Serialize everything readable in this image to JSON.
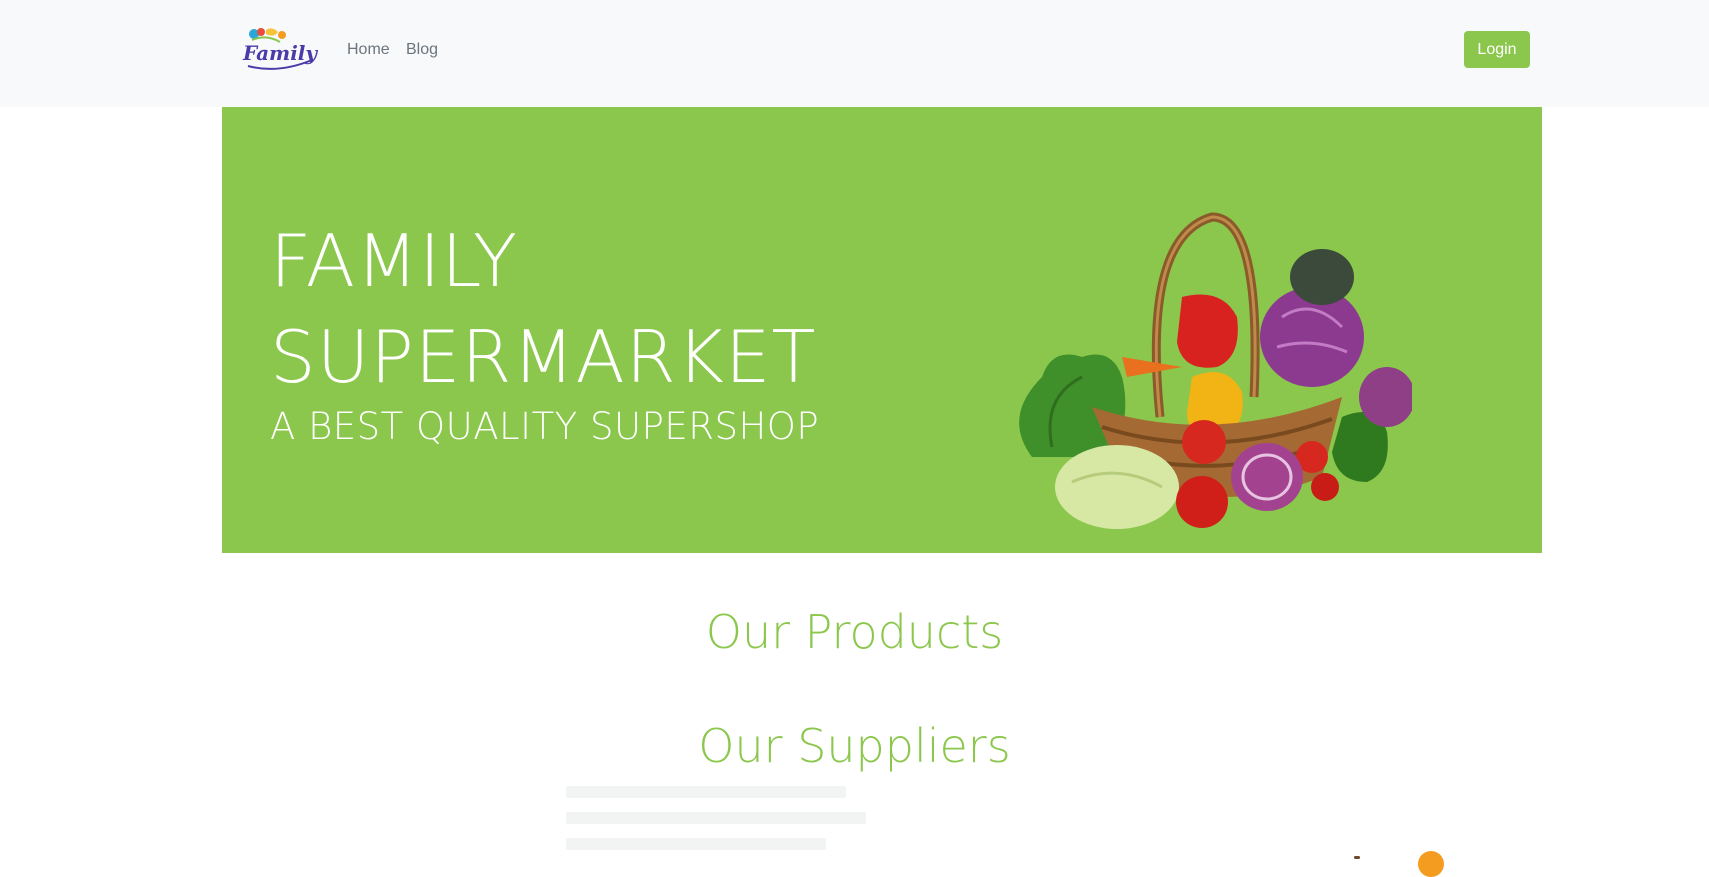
{
  "navbar": {
    "logo_text": "Family",
    "links": [
      {
        "label": "Home"
      },
      {
        "label": "Blog"
      }
    ],
    "login_label": "Login"
  },
  "hero": {
    "title_line1": "FAMILY",
    "title_line2": "SUPERMARKET",
    "subtitle": "A BEST QUALITY SUPERSHOP"
  },
  "sections": {
    "products_heading": "Our Products",
    "suppliers_heading": "Our Suppliers"
  },
  "colors": {
    "brand_green": "#8bc74c",
    "navbar_bg": "#f8f9fa",
    "nav_link": "#6c757d",
    "logo_purple": "#4b3aa8"
  },
  "icons": {
    "logo": "family-logo-icon",
    "hero_image": "vegetable-basket-icon"
  }
}
